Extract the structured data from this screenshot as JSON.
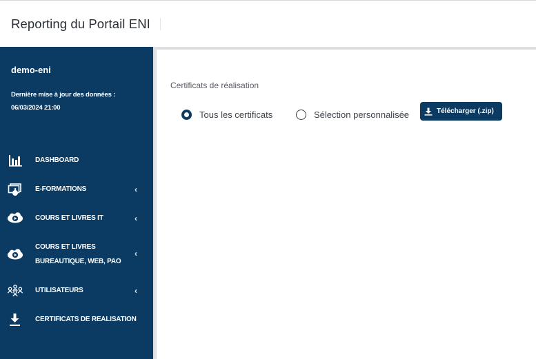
{
  "header": {
    "title": "Reporting du Portail ENI"
  },
  "sidebar": {
    "username": "demo-eni",
    "update_label": "Dernière mise à jour des données :",
    "update_datetime": "06/03/2024 21:00",
    "items": [
      {
        "label": "DASHBOARD",
        "icon": "bar-chart-icon",
        "has_submenu": false
      },
      {
        "label": "E-FORMATIONS",
        "icon": "screen-touch-icon",
        "has_submenu": true
      },
      {
        "label": "COURS ET LIVRES IT",
        "icon": "cloud-play-icon",
        "has_submenu": true
      },
      {
        "label_line1": "COURS ET LIVRES",
        "label_line2": "BUREAUTIQUE, WEB, PAO",
        "icon": "cloud-play-icon",
        "has_submenu": true
      },
      {
        "label": "UTILISATEURS",
        "icon": "users-group-icon",
        "has_submenu": true
      },
      {
        "label": "CERTIFICATS DE REALISATION",
        "icon": "download-icon",
        "has_submenu": false
      }
    ],
    "chevron": "‹"
  },
  "main": {
    "section_title": "Certificats de réalisation",
    "options": [
      {
        "label": "Tous les certificats",
        "checked": true
      },
      {
        "label": "Sélection personnalisée",
        "checked": false
      }
    ],
    "download_button": {
      "label": "Télécharger (.zip)",
      "icon": "download-icon"
    }
  },
  "colors": {
    "sidebar_bg": "#0b3b62",
    "accent": "#0b3b62",
    "text": "#2b2f36"
  }
}
